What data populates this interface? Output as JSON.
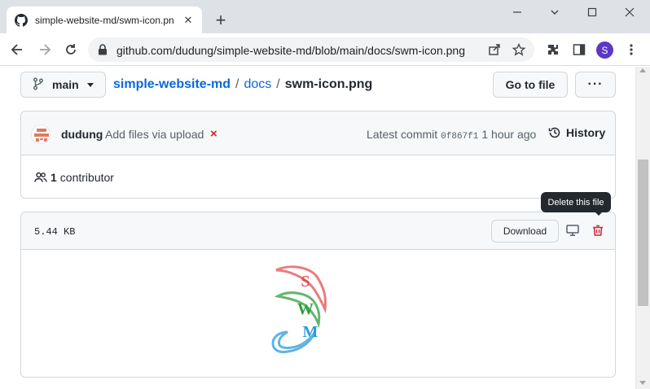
{
  "browser": {
    "tab_title": "simple-website-md/swm-icon.pn",
    "url": "github.com/dudung/simple-website-md/blob/main/docs/swm-icon.png",
    "profile_initial": "S"
  },
  "repo": {
    "branch": "main",
    "repo_name": "simple-website-md",
    "separator": "/",
    "folder": "docs",
    "file_name": "swm-icon.png",
    "goto_file_label": "Go to file",
    "more_label": "···"
  },
  "commit": {
    "author": "dudung",
    "message": "Add files via upload",
    "status_mark": "×",
    "latest_label": "Latest commit",
    "sha": "0f867f1",
    "time": "1 hour ago",
    "history_label": "History",
    "contributor_count": "1",
    "contributor_label": "contributor"
  },
  "file": {
    "size": "5.44 KB",
    "download_label": "Download",
    "tooltip": "Delete this file"
  },
  "preview": {
    "letters": [
      "S",
      "W",
      "M"
    ],
    "colors": {
      "s": "#e0504f",
      "w": "#2e9e3e",
      "m": "#2a9bd8"
    }
  },
  "colors": {
    "link": "#0969da",
    "danger": "#cf222e",
    "border": "#d0d7de",
    "profile": "#5b39c4"
  }
}
